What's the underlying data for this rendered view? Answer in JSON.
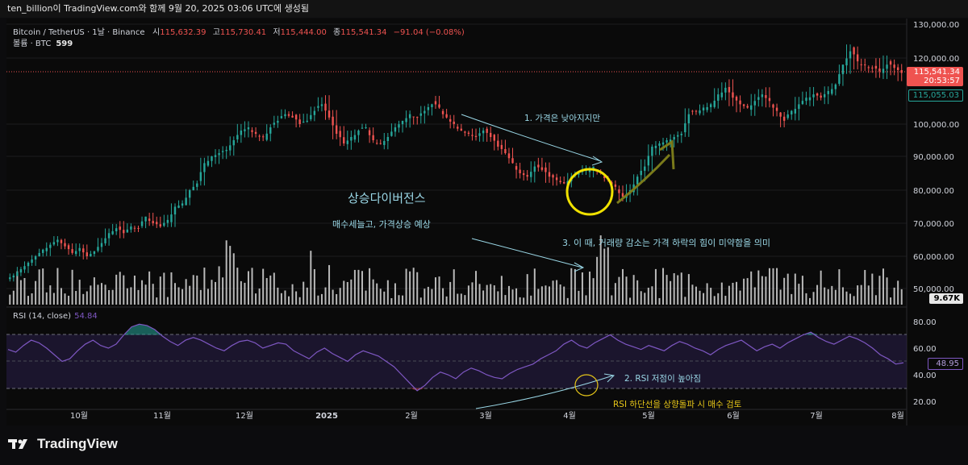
{
  "header": {
    "caption": "ten_billion이 TradingView.com와 함께 9월 20, 2025 03:06 UTC에 생성됨"
  },
  "legend": {
    "symbol": "Bitcoin / TetherUS · 1날 · Binance",
    "open_label": "시",
    "open": "115,632.39",
    "high_label": "고",
    "high": "115,730.41",
    "low_label": "저",
    "low": "115,444.00",
    "close_label": "종",
    "close": "115,541.34",
    "change": "−91.04 (−0.08%)"
  },
  "volume_legend": {
    "label": "볼륨 · BTC",
    "value": "599"
  },
  "rsi_legend": {
    "label": "RSI (14, close)",
    "value": "54.84"
  },
  "price_axis": {
    "ticks": [
      "130,000.00",
      "120,000.00",
      "100,000.00",
      "90,000.00",
      "80,000.00",
      "70,000.00",
      "60,000.00",
      "50,000.00"
    ],
    "last_price": "115,541.34",
    "countdown": "20:53:57",
    "prev_price": "115,055.03",
    "volume_tag": "9.67K"
  },
  "rsi_axis": {
    "ticks": [
      "80.00",
      "60.00",
      "40.00",
      "20.00"
    ],
    "value_tag": "48.95"
  },
  "time_axis": {
    "labels": [
      "10월",
      "11월",
      "12월",
      "2025",
      "2월",
      "3월",
      "4월",
      "5월",
      "6월",
      "7월",
      "8월"
    ]
  },
  "annotations": {
    "price_note": "1. 가격은 낮아지지만",
    "divergence_title": "상승다이버전스",
    "divergence_sub": "매수세늘고, 가격상승 예상",
    "volume_note": "3. 이 때, 거래량 감소는 가격 하락의 힘이 미약함을 의미",
    "rsi_note": "2. RSI 저점이 높아짐",
    "rsi_buy_note": "RSI 하단선을 상향돌파 시 매수 검토"
  },
  "brand": {
    "logo_text": "TradingView"
  },
  "colors": {
    "up": "#26a69a",
    "down": "#ef5350",
    "rsi_line": "#7e57c2",
    "rsi_band": "#2a1f4a",
    "annotation_blue": "#9ad7e6",
    "annotation_yellow": "#e6c619",
    "arrow_olive": "#7a7a1a"
  },
  "chart_data": {
    "type": "candlestick",
    "price_axis_ticks": [
      130000,
      120000,
      100000,
      90000,
      80000,
      70000,
      60000,
      50000
    ],
    "rsi_axis_ticks": [
      80,
      60,
      40,
      20
    ],
    "series": [
      {
        "name": "Bitcoin / TetherUS",
        "kind": "close_approx",
        "start": "2024-09-06",
        "values": [
          54000,
          56000,
          58000,
          60000,
          62000,
          63500,
          65000,
          63000,
          61000,
          62500,
          60000,
          61500,
          64000,
          67000,
          68500,
          67000,
          69000,
          68500,
          72000,
          70000,
          69000,
          71000,
          75000,
          76000,
          80000,
          82000,
          88000,
          90000,
          91000,
          92000,
          95000,
          98000,
          99000,
          97000,
          96000,
          99000,
          101000,
          103000,
          102000,
          100000,
          101000,
          104000,
          106000,
          102000,
          97000,
          94000,
          96000,
          98000,
          99000,
          95000,
          94000,
          96000,
          99000,
          101000,
          103000,
          102000,
          104000,
          106000,
          105000,
          102000,
          100000,
          98000,
          97000,
          96000,
          98000,
          96000,
          93000,
          91000,
          88000,
          85000,
          84000,
          87000,
          86000,
          84000,
          83000,
          82000,
          84000,
          85000,
          86000,
          87000,
          85000,
          83000,
          81000,
          78000,
          80000,
          84000,
          87000,
          93000,
          94000,
          95000,
          96000,
          97000,
          103000,
          104000,
          105000,
          106000,
          109000,
          111000,
          108000,
          106000,
          105000,
          107000,
          109000,
          107000,
          104000,
          101000,
          104000,
          106000,
          108000,
          109000,
          108000,
          110000,
          112000,
          118000,
          122000,
          119000,
          118000,
          117000,
          116000,
          118000,
          117000,
          115500
        ]
      },
      {
        "name": "RSI (14, close)",
        "values": [
          59,
          57,
          62,
          66,
          64,
          60,
          55,
          50,
          52,
          58,
          63,
          66,
          62,
          60,
          63,
          70,
          76,
          78,
          77,
          74,
          69,
          65,
          62,
          66,
          68,
          66,
          63,
          60,
          58,
          62,
          65,
          66,
          64,
          60,
          62,
          64,
          63,
          58,
          55,
          52,
          57,
          60,
          56,
          53,
          50,
          55,
          58,
          56,
          54,
          50,
          46,
          40,
          34,
          28,
          32,
          38,
          42,
          40,
          37,
          42,
          45,
          43,
          40,
          38,
          37,
          41,
          44,
          46,
          48,
          52,
          55,
          58,
          63,
          66,
          62,
          60,
          64,
          67,
          70,
          66,
          63,
          61,
          59,
          62,
          60,
          58,
          62,
          65,
          63,
          60,
          58,
          55,
          59,
          62,
          64,
          66,
          62,
          58,
          61,
          63,
          60,
          64,
          67,
          70,
          72,
          68,
          65,
          63,
          66,
          69,
          67,
          64,
          60,
          55,
          52,
          48,
          49
        ]
      }
    ]
  }
}
